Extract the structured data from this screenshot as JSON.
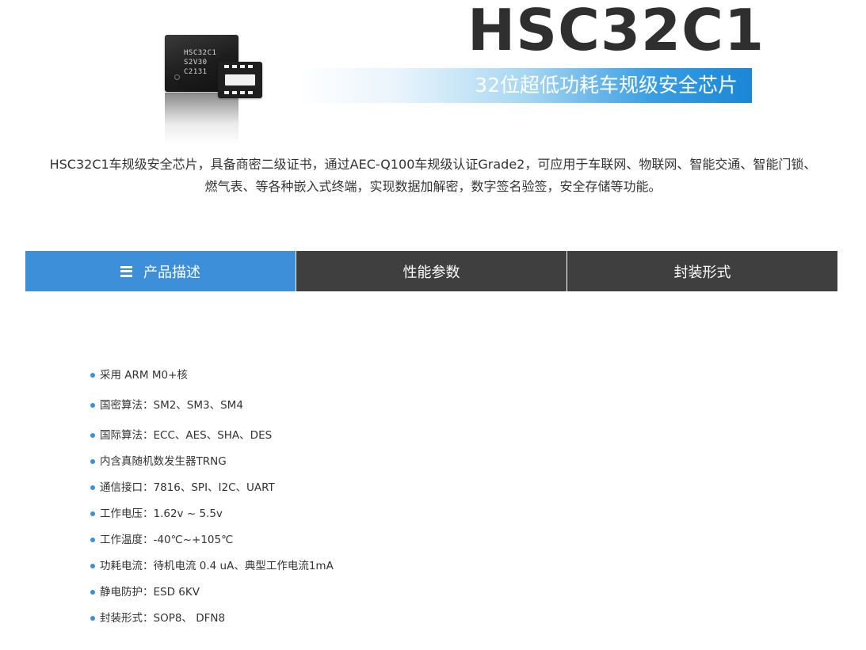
{
  "hero": {
    "title": "HSC32C1",
    "subtitle": "32位超低功耗车规级安全芯片",
    "chip_label": {
      "line1": "HSC32C1",
      "line2": "S2V30",
      "line3": "C2131"
    }
  },
  "description": {
    "line1": "HSC32C1车规级安全芯片，具备商密二级证书，通过AEC-Q100车规级认证Grade2，可应用于车联网、物联网、智能交通、智能门锁、",
    "line2": "燃气表、等各种嵌入式终端，实现数据加解密，数字签名验签，安全存储等功能。"
  },
  "tabs": [
    {
      "label": "产品描述",
      "active": true,
      "icon": "menu-icon"
    },
    {
      "label": "性能参数",
      "active": false
    },
    {
      "label": "封装形式",
      "active": false
    }
  ],
  "features": [
    "采用 ARM M0+核",
    "国密算法：SM2、SM3、SM4",
    "国际算法：ECC、AES、SHA、DES",
    "内含真随机数发生器TRNG",
    "通信接口：7816、SPI、I2C、UART",
    "工作电压：1.62v ~ 5.5v",
    "工作温度：-40℃~+105℃",
    "功耗电流：待机电流 0.4 uA、典型工作电流1mA",
    "静电防护：ESD 6KV",
    "封装形式：SOP8、 DFN8"
  ],
  "colors": {
    "accent": "#3d8fd9",
    "tab_dark": "#3f3f3f",
    "title": "#2f2f2f",
    "text": "#333333"
  }
}
